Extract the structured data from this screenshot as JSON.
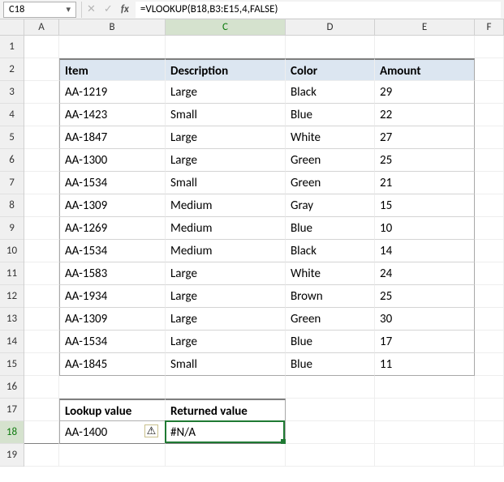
{
  "formula_bar": {
    "cell_ref": "C18",
    "formula": "=VLOOKUP(B18,B3:E15,4,FALSE)"
  },
  "columns": [
    "A",
    "B",
    "C",
    "D",
    "E",
    "F"
  ],
  "row_numbers": [
    "1",
    "2",
    "3",
    "4",
    "5",
    "6",
    "7",
    "8",
    "9",
    "10",
    "11",
    "12",
    "13",
    "14",
    "15",
    "16",
    "17",
    "18",
    "19"
  ],
  "active": {
    "col": "C",
    "row": "18"
  },
  "table": {
    "headers": {
      "item": "Item",
      "description": "Description",
      "color": "Color",
      "amount": "Amount"
    },
    "rows": [
      {
        "item": "AA-1219",
        "description": "Large",
        "color": "Black",
        "amount": "29"
      },
      {
        "item": "AA-1423",
        "description": "Small",
        "color": "Blue",
        "amount": "22"
      },
      {
        "item": "AA-1847",
        "description": "Large",
        "color": "White",
        "amount": "27"
      },
      {
        "item": "AA-1300",
        "description": "Large",
        "color": "Green",
        "amount": "25"
      },
      {
        "item": "AA-1534",
        "description": "Small",
        "color": "Green",
        "amount": "21"
      },
      {
        "item": "AA-1309",
        "description": "Medium",
        "color": "Gray",
        "amount": "15"
      },
      {
        "item": "AA-1269",
        "description": "Medium",
        "color": "Blue",
        "amount": "10"
      },
      {
        "item": "AA-1534",
        "description": "Medium",
        "color": "Black",
        "amount": "14"
      },
      {
        "item": "AA-1583",
        "description": "Large",
        "color": "White",
        "amount": "24"
      },
      {
        "item": "AA-1934",
        "description": "Large",
        "color": "Brown",
        "amount": "25"
      },
      {
        "item": "AA-1309",
        "description": "Large",
        "color": "Green",
        "amount": "30"
      },
      {
        "item": "AA-1534",
        "description": "Large",
        "color": "Blue",
        "amount": "17"
      },
      {
        "item": "AA-1845",
        "description": "Small",
        "color": "Blue",
        "amount": "11"
      }
    ]
  },
  "lookup": {
    "headers": {
      "lookup": "Lookup value",
      "returned": "Returned value"
    },
    "value": "AA-1400",
    "result": "#N/A"
  },
  "icons": {
    "warning": "⚠"
  }
}
